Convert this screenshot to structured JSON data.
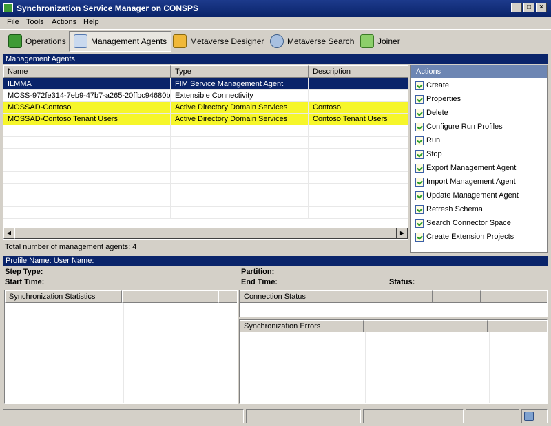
{
  "window": {
    "title": "Synchronization Service Manager on CONSPS"
  },
  "menu": [
    "File",
    "Tools",
    "Actions",
    "Help"
  ],
  "toolbar": {
    "buttons": [
      {
        "label": "Operations",
        "icon": "operations-icon"
      },
      {
        "label": "Management Agents",
        "icon": "management-agents-icon",
        "active": true
      },
      {
        "label": "Metaverse Designer",
        "icon": "metaverse-designer-icon"
      },
      {
        "label": "Metaverse Search",
        "icon": "metaverse-search-icon"
      },
      {
        "label": "Joiner",
        "icon": "joiner-icon"
      }
    ]
  },
  "management_agents": {
    "header": "Management Agents",
    "columns": [
      "Name",
      "Type",
      "Description"
    ],
    "rows": [
      {
        "name": "ILMMA",
        "type": "FIM Service Management Agent",
        "description": "",
        "state": "selected"
      },
      {
        "name": "MOSS-972fe314-7eb9-47b7-a265-20ffbc94680b",
        "type": "Extensible Connectivity",
        "description": "",
        "state": "normal"
      },
      {
        "name": "MOSSAD-Contoso",
        "type": "Active Directory Domain Services",
        "description": "Contoso",
        "state": "highlight"
      },
      {
        "name": "MOSSAD-Contoso Tenant Users",
        "type": "Active Directory Domain Services",
        "description": "Contoso Tenant Users",
        "state": "highlight"
      }
    ],
    "total_text": "Total number of management agents: 4"
  },
  "actions": {
    "header": "Actions",
    "items": [
      "Create",
      "Properties",
      "Delete",
      "Configure Run Profiles",
      "Run",
      "Stop",
      "Export Management Agent",
      "Import Management Agent",
      "Update Management Agent",
      "Refresh Schema",
      "Search Connector Space",
      "Create Extension Projects"
    ]
  },
  "run_details": {
    "header": "Profile Name:   User Name:",
    "step_type": "Step Type:",
    "start_time": "Start Time:",
    "partition": "Partition:",
    "end_time": "End Time:",
    "status": "Status:",
    "sync_stats_header": "Synchronization Statistics",
    "connection_status_header": "Connection Status",
    "sync_errors_header": "Synchronization Errors"
  }
}
